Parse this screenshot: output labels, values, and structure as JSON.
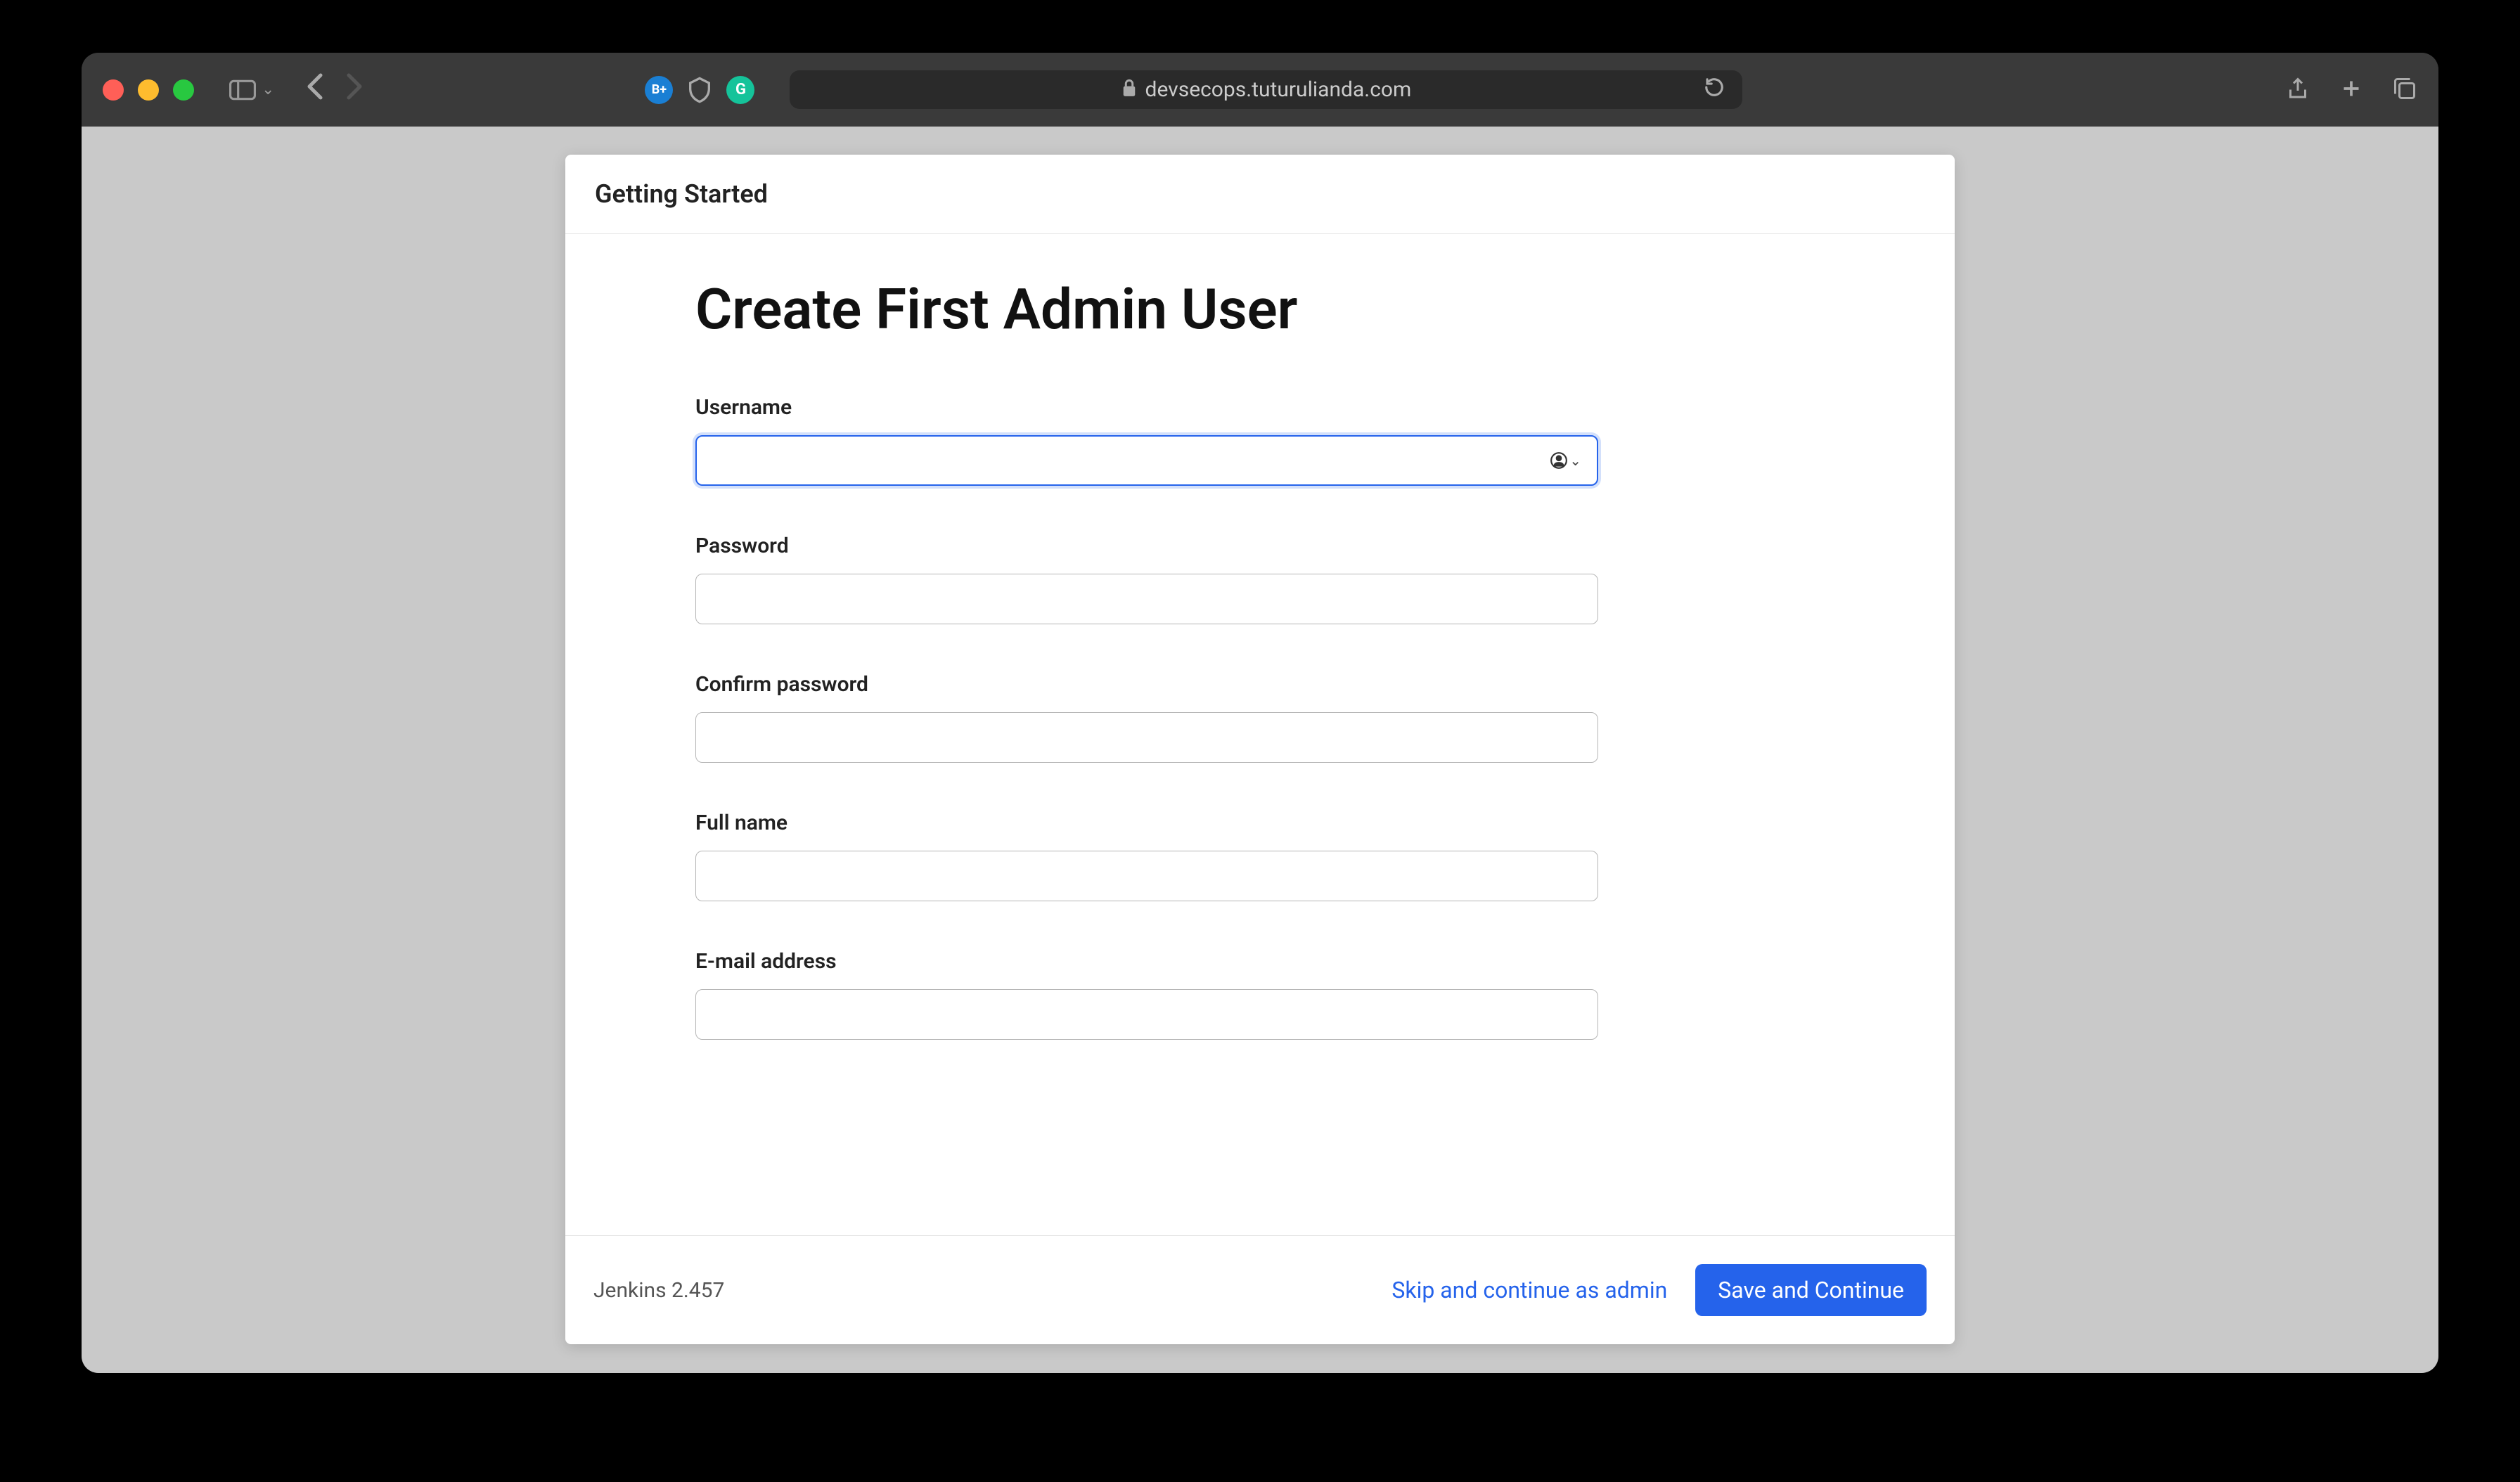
{
  "browser": {
    "url": "devsecops.tuturulianda.com"
  },
  "dialog": {
    "header": "Getting Started",
    "title": "Create First Admin User"
  },
  "form": {
    "username": {
      "label": "Username",
      "value": ""
    },
    "password": {
      "label": "Password",
      "value": ""
    },
    "confirm_password": {
      "label": "Confirm password",
      "value": ""
    },
    "full_name": {
      "label": "Full name",
      "value": ""
    },
    "email": {
      "label": "E-mail address",
      "value": ""
    }
  },
  "footer": {
    "version": "Jenkins 2.457",
    "skip_label": "Skip and continue as admin",
    "save_label": "Save and Continue"
  }
}
